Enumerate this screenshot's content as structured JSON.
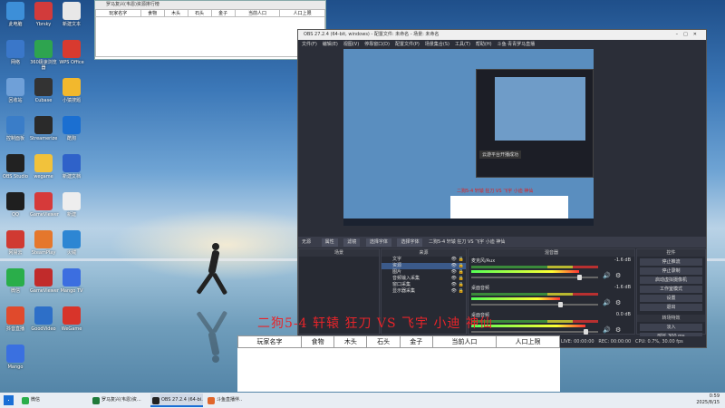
{
  "desktop": {
    "icons": [
      {
        "label": "此电脑",
        "color": "#3d8fd8"
      },
      {
        "label": "Ybrsky",
        "color": "#d23b3b"
      },
      {
        "label": "新建文本",
        "color": "#e8e8e8"
      },
      {
        "label": "网络",
        "color": "#3a77c9"
      },
      {
        "label": "360极速浏览器",
        "color": "#2ea44f"
      },
      {
        "label": "WPS Office",
        "color": "#d83a2f"
      },
      {
        "label": "回收站",
        "color": "#6fa0d8"
      },
      {
        "label": "Cubase",
        "color": "#333"
      },
      {
        "label": "小猿搜题",
        "color": "#f2b82d"
      },
      {
        "label": "控制面板",
        "color": "#3a7dc8"
      },
      {
        "label": "Streamerize",
        "color": "#2a2a2a"
      },
      {
        "label": "酷狗",
        "color": "#1b6fd1"
      },
      {
        "label": "OBS Studio",
        "color": "#222"
      },
      {
        "label": "wegame",
        "color": "#f2c23b"
      },
      {
        "label": "新建文档",
        "color": "#2f62c9"
      },
      {
        "label": "QQ",
        "color": "#1f1f1f"
      },
      {
        "label": "GameViewer",
        "color": "#d63a3a"
      },
      {
        "label": "新建",
        "color": "#eee"
      },
      {
        "label": "网易云",
        "color": "#d03a32"
      },
      {
        "label": "SteamPlay",
        "color": "#e5772c"
      },
      {
        "label": "火绒",
        "color": "#2d86d3"
      },
      {
        "label": "微信",
        "color": "#2aae4a"
      },
      {
        "label": "GameViewer",
        "color": "#c12b2b"
      },
      {
        "label": "Mango TV",
        "color": "#3c6ee0"
      },
      {
        "label": "抖音直播",
        "color": "#e04a2c"
      },
      {
        "label": "GoodVideo",
        "color": "#2d6fc8"
      },
      {
        "label": "WeGame",
        "color": "#d8342a"
      },
      {
        "label": "Mango",
        "color": "#3a70e0"
      }
    ]
  },
  "top_excel": {
    "title": "罗马复兴(韦恩)资源排行榜",
    "headers": [
      "玩家名字",
      "食物",
      "木头",
      "石头",
      "金子",
      "当前人口",
      "人口上限"
    ]
  },
  "obs": {
    "title": "OBS 27.2.4 (64-bit, windows) - 配置文件: 未命名 - 场景: 未命名",
    "menu": [
      "文件(F)",
      "编辑(E)",
      "视图(V)",
      "停靠窗口(D)",
      "配置文件(P)",
      "场景集合(S)",
      "工具(T)",
      "帮助(H)",
      "斗鱼·青青罗马直播"
    ],
    "preview_red_text": "二狗5-4 轩辕 狂刀 VS 飞宇 小迪 神仙",
    "preview_recent": "云游平台开播成功",
    "source_label": "无源",
    "toolbar": {
      "properties": "属性",
      "filters": "滤镜",
      "color": "选择字体",
      "text": "选择字体",
      "preview_text": "二狗5-4 轩辕 狂刀 VS 飞宇 小迪 神仙"
    },
    "panels": {
      "scenes": "场景",
      "sources": "来源",
      "mixer": "混音器",
      "controls": "控件"
    },
    "sources": [
      {
        "name": "文字",
        "selected": false
      },
      {
        "name": "资源",
        "selected": true
      },
      {
        "name": "图片",
        "selected": false
      },
      {
        "name": "音频输入采集",
        "selected": false
      },
      {
        "name": "窗口采集",
        "selected": false
      },
      {
        "name": "显示器采集",
        "selected": false
      }
    ],
    "mixer": [
      {
        "name": "麦克风/Aux",
        "db": "-1.6 dB",
        "level": 0.85
      },
      {
        "name": "桌面音频",
        "db": "-1.6 dB",
        "level": 0.7
      },
      {
        "name": "桌面音频",
        "db": "0.0 dB",
        "level": 0.9
      }
    ],
    "controls": [
      "停止推流",
      "停止录制",
      "启动虚拟摄像机",
      "工作室模式",
      "设置",
      "退出"
    ],
    "transitions": {
      "label": "转场特效",
      "type": "淡入",
      "duration_label": "时长",
      "duration": "300 ms"
    },
    "status": {
      "live": "LIVE: 00:00:00",
      "rec": "REC: 00:00:00",
      "cpu": "CPU: 0.7%, 30.00 fps"
    }
  },
  "overlay": {
    "text": "二狗5-4 轩辕 狂刀 VS 飞宇 小迪 神仙",
    "headers": [
      "玩家名字",
      "食物",
      "木头",
      "石头",
      "金子",
      "当前人口",
      "人口上限"
    ]
  },
  "taskbar": {
    "items": [
      {
        "label": "微信",
        "color": "#2aae4a"
      },
      {
        "label": "罗马复兴(韦恩)资...",
        "color": "#1f7a3a"
      },
      {
        "label": "OBS 27.2.4 (64-bi...",
        "color": "#222"
      },
      {
        "label": "斗鱼直播伴...",
        "color": "#e0662a"
      }
    ],
    "time": "0:59",
    "date": "2025/8/15"
  }
}
